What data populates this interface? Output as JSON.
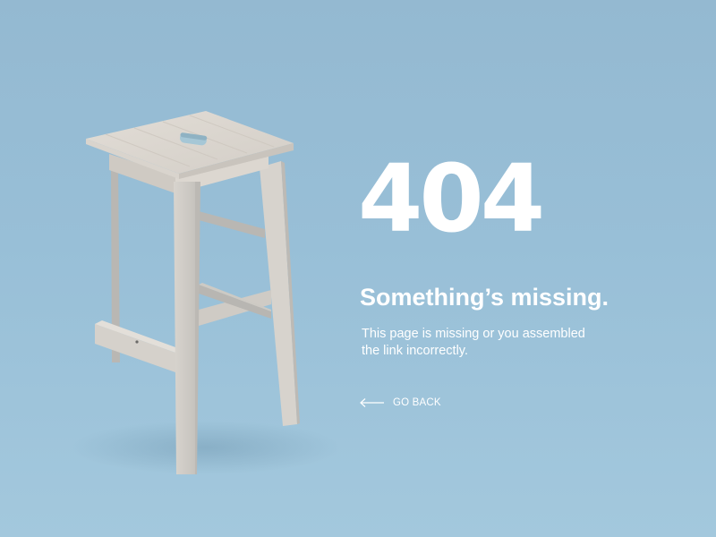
{
  "error": {
    "code": "404",
    "headline": "Something’s missing.",
    "message": "This page is missing or you assembled the link incorrectly."
  },
  "navigation": {
    "go_back_label": "GO BACK",
    "go_back_icon": "arrow-left-icon"
  },
  "illustration": {
    "subject": "wooden-stool-image"
  },
  "colors": {
    "background": "#98bfd7",
    "text": "#ffffff",
    "wood": "#d7d3cd"
  }
}
